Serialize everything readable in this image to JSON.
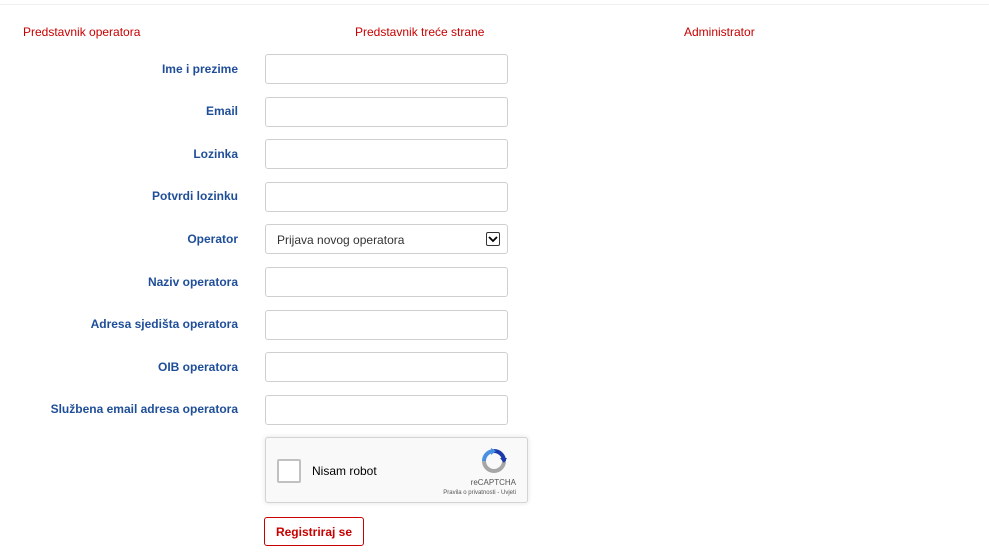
{
  "tabs": [
    {
      "label": "Predstavnik operatora"
    },
    {
      "label": "Predstavnik treće strane"
    },
    {
      "label": "Administrator"
    }
  ],
  "form": {
    "full_name": {
      "label": "Ime i prezime",
      "value": ""
    },
    "email": {
      "label": "Email",
      "value": ""
    },
    "password": {
      "label": "Lozinka",
      "value": ""
    },
    "confirm_password": {
      "label": "Potvrdi lozinku",
      "value": ""
    },
    "operator": {
      "label": "Operator",
      "selected": "Prijava novog operatora"
    },
    "operator_name": {
      "label": "Naziv operatora",
      "value": ""
    },
    "operator_address": {
      "label": "Adresa sjedišta operatora",
      "value": ""
    },
    "operator_oib": {
      "label": "OIB operatora",
      "value": ""
    },
    "operator_email": {
      "label": "Službena email adresa operatora",
      "value": ""
    }
  },
  "captcha": {
    "label": "Nisam robot",
    "brand": "reCAPTCHA",
    "privacy": "Pravila o privatnosti",
    "separator": " - ",
    "terms": "Uvjeti",
    "icon": "recaptcha-logo-icon"
  },
  "submit": {
    "label": "Registriraj se"
  },
  "colors": {
    "accent": "#c80000",
    "label": "#1f4e99"
  }
}
